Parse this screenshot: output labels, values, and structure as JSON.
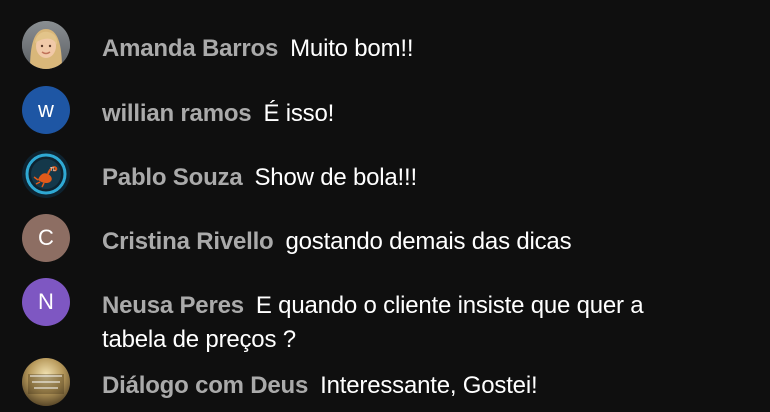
{
  "messages": [
    {
      "author": "Amanda Barros",
      "text": "Muito bom!!",
      "avatar": {
        "type": "photo",
        "icon": "profile-photo-blonde-woman"
      }
    },
    {
      "author": "willian ramos",
      "text": "É isso!",
      "avatar": {
        "type": "initial",
        "initial": "W",
        "color": "#1e56a4"
      }
    },
    {
      "author": "Pablo Souza",
      "text": "Show de bola!!!",
      "avatar": {
        "type": "photo",
        "icon": "scorpion-emblem"
      }
    },
    {
      "author": "Cristina Rivello",
      "text": "gostando demais das dicas",
      "avatar": {
        "type": "initial",
        "initial": "C",
        "color": "#8d6e63"
      }
    },
    {
      "author": "Neusa Peres",
      "text": "E quando o cliente insiste que quer a tabela de preços ?",
      "avatar": {
        "type": "initial",
        "initial": "N",
        "color": "#7e57c2"
      }
    },
    {
      "author": "Diálogo com Deus",
      "text": "Interessante, Gostei!",
      "avatar": {
        "type": "photo",
        "icon": "dialogo-com-deus-logo"
      }
    }
  ],
  "colors": {
    "background": "#0f0f0f",
    "author": "#aaaaaa",
    "message": "#ffffff"
  }
}
